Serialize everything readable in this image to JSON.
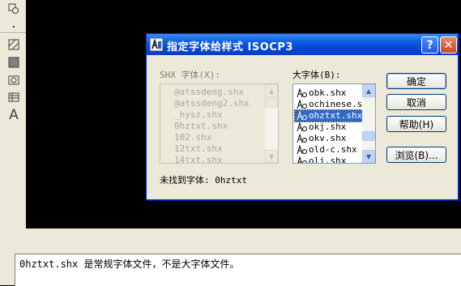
{
  "dialog": {
    "title": "指定字体给样式 ISOCP3",
    "shx_label": "SHX 字体(X):",
    "big_label": "大字体(B):",
    "shx_fonts": [
      "@atssdeng.shx",
      "@atssdeng2.shx",
      "_hysz.shx",
      "0hztxt.shx",
      "102.shx",
      "12txt.shx",
      "14txt.shx"
    ],
    "big_fonts": [
      "obk.shx",
      "ochinese.sh",
      "ohztxt.shx",
      "okj.shx",
      "okv.shx",
      "old-c.shx",
      "oli.shx"
    ],
    "selected_big_font": "ohztxt.shx",
    "not_found": "未找到字体: 0hztxt",
    "buttons": {
      "ok": "确定",
      "cancel": "取消",
      "help": "帮助(H)",
      "browse": "浏览(B)..."
    },
    "help_glyph": "?",
    "close_glyph": "✕"
  },
  "command_line": {
    "text": "0hztxt.shx 是常规字体文件，不是大字体文件。"
  },
  "toolbar": {
    "text_tool_glyph": "A"
  },
  "colors": {
    "title_bar": "#0a5ae0",
    "selection": "#316ac5",
    "model_space": "#000000"
  }
}
